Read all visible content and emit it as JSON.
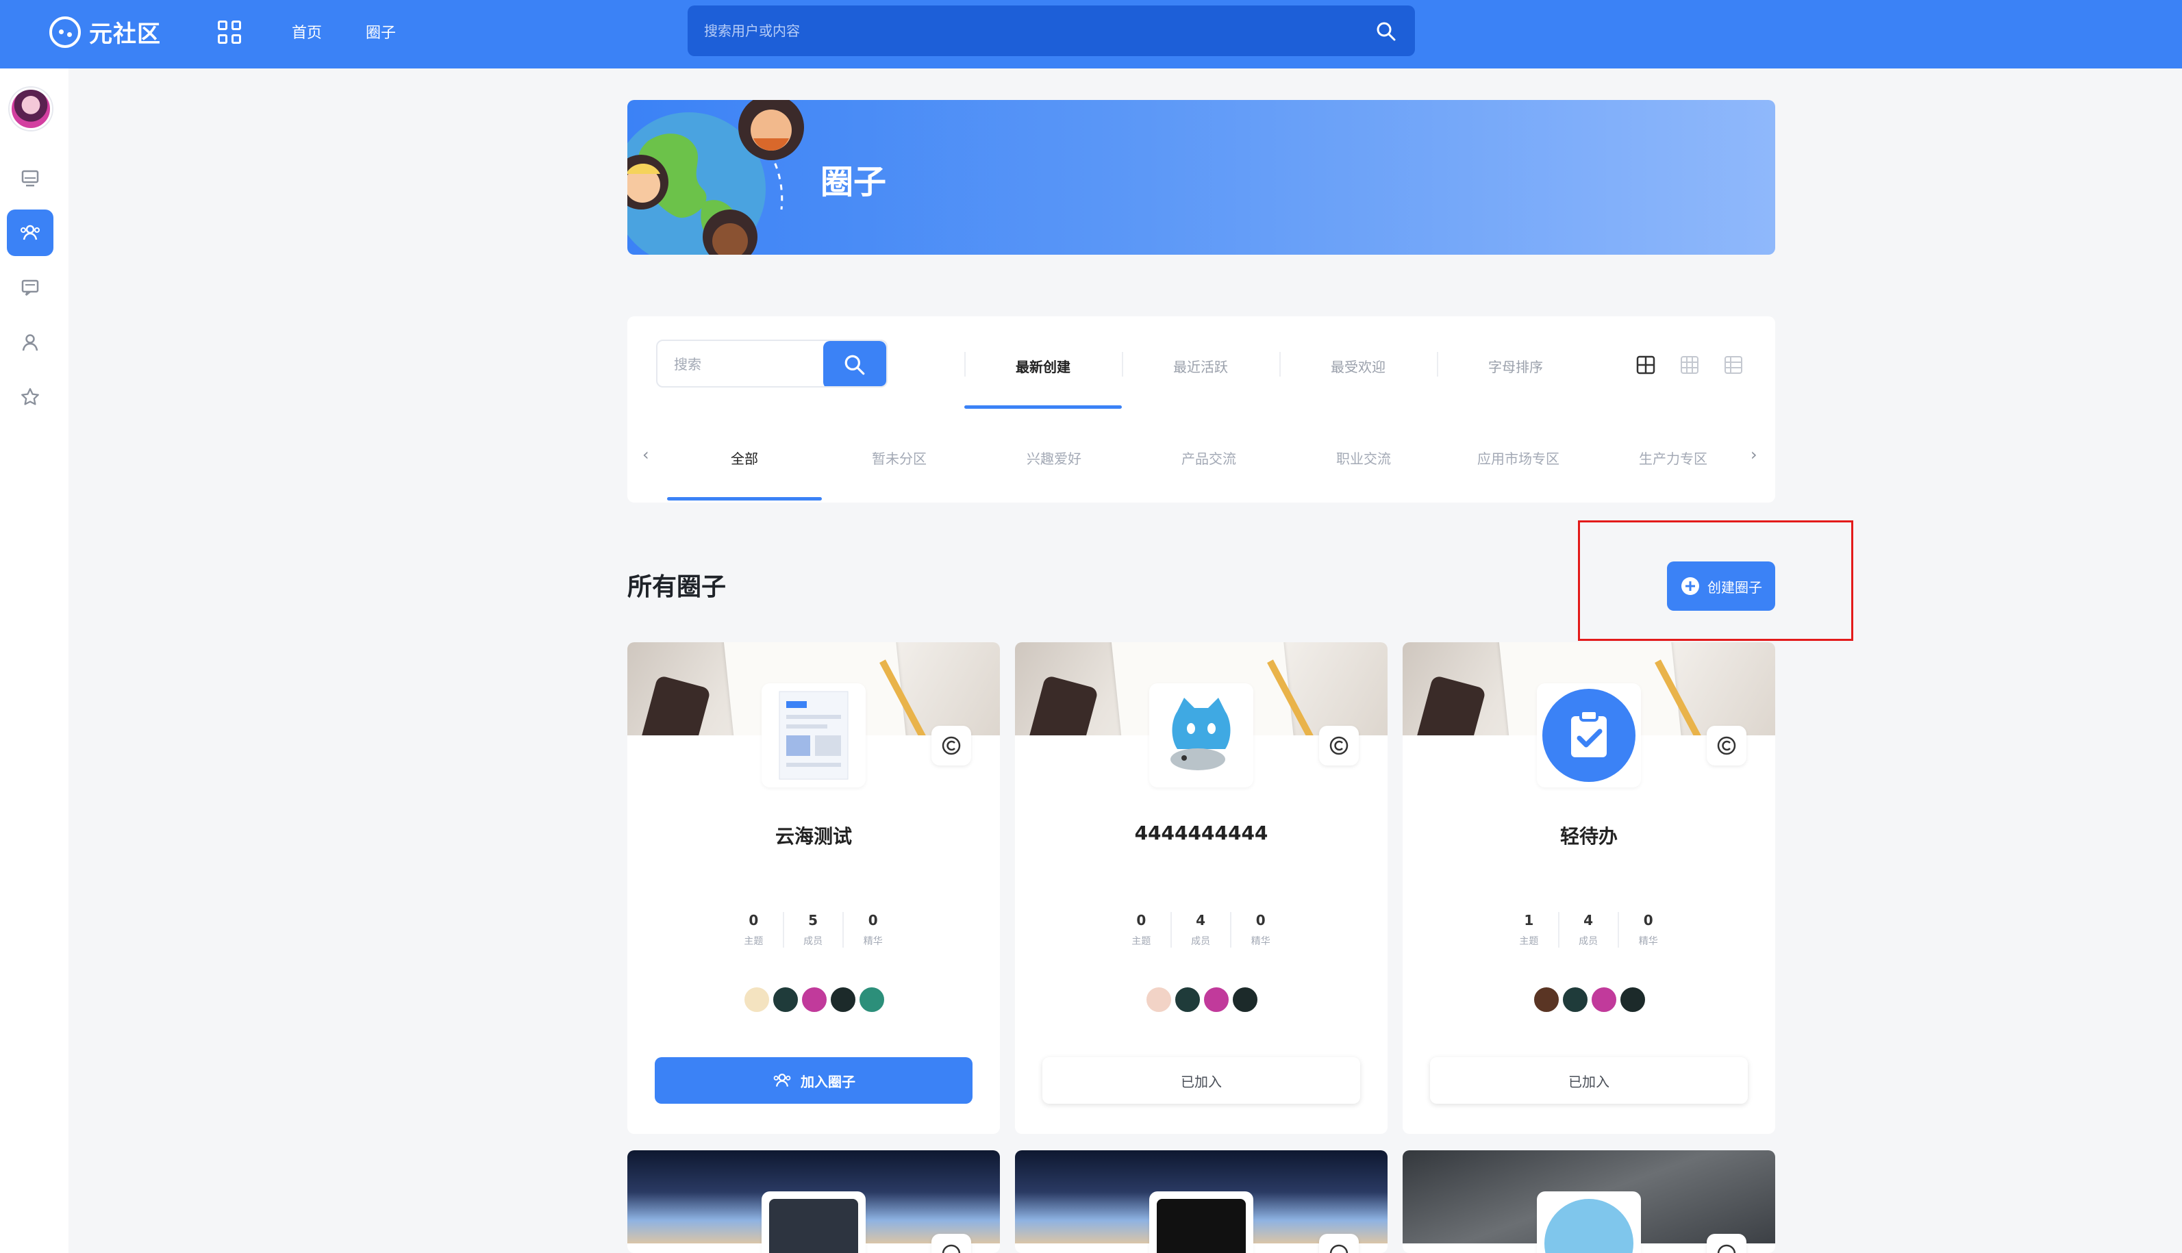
{
  "topbar": {
    "logo_text": "元社区",
    "nav": [
      "首页",
      "圈子"
    ],
    "search_placeholder": "搜索用户或内容"
  },
  "sidebar": {
    "items": [
      "monitor-icon",
      "community-icon",
      "message-icon",
      "user-icon",
      "star-icon"
    ],
    "active": "community-icon"
  },
  "banner": {
    "title": "圈子"
  },
  "filter": {
    "search_placeholder": "搜索",
    "sort_tabs": [
      "最新创建",
      "最近活跃",
      "最受欢迎",
      "字母排序"
    ],
    "sort_active": "最新创建",
    "categories": [
      "全部",
      "暂未分区",
      "兴趣爱好",
      "产品交流",
      "职业交流",
      "应用市场专区",
      "生产力专区"
    ],
    "category_active": "全部",
    "prev_arrow": "‹",
    "next_arrow": "›"
  },
  "section": {
    "title": "所有圈子",
    "create_label": "创建圈子"
  },
  "stat_labels": [
    "主题",
    "成员",
    "精华"
  ],
  "circles": [
    {
      "name": "云海测试",
      "topics": "0",
      "members": "5",
      "featured": "0",
      "action": "加入圈子"
    },
    {
      "name": "4444444444",
      "topics": "0",
      "members": "4",
      "featured": "0",
      "action": "已加入"
    },
    {
      "name": "轻待办",
      "topics": "1",
      "members": "4",
      "featured": "0",
      "action": "已加入"
    }
  ],
  "colors": {
    "primary": "#3b82f6",
    "highlight_frame": "#e31b1b"
  }
}
